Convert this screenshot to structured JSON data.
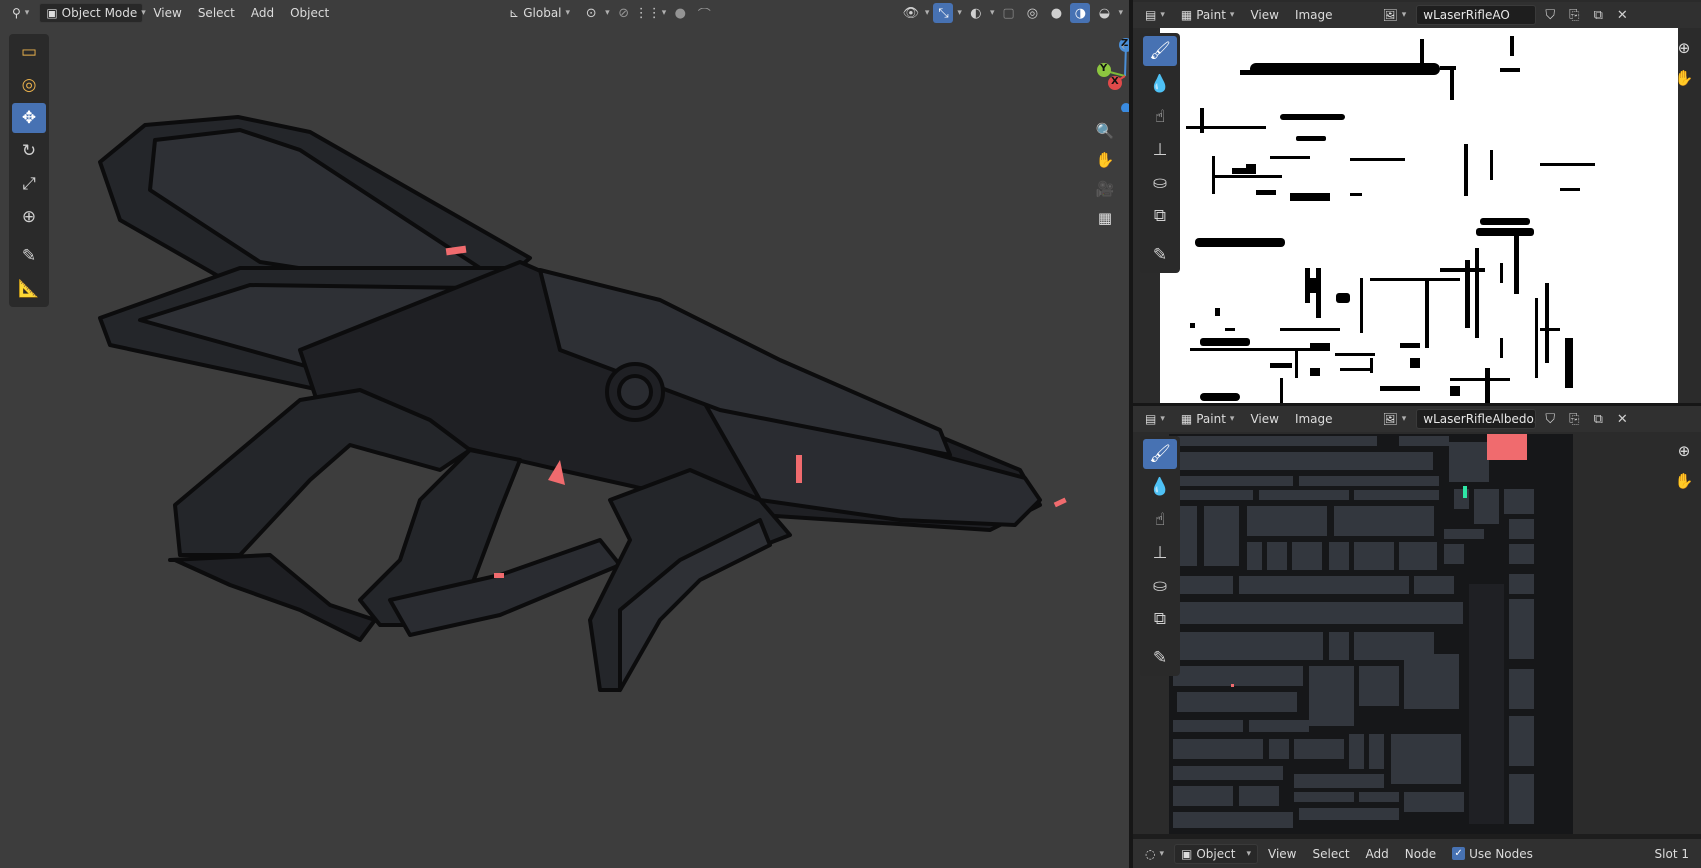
{
  "viewport": {
    "header": {
      "editor_type_icon": "axes-icon",
      "mode": "Object Mode",
      "menus": [
        "View",
        "Select",
        "Add",
        "Object"
      ],
      "orientation": "Global"
    },
    "tools": [
      {
        "name": "select-box-tool",
        "icon": "▭"
      },
      {
        "name": "cursor-tool",
        "icon": "◎"
      },
      {
        "name": "move-tool",
        "icon": "✥",
        "active": true
      },
      {
        "name": "rotate-tool",
        "icon": "↻"
      },
      {
        "name": "scale-tool",
        "icon": "⤢"
      },
      {
        "name": "transform-tool",
        "icon": "⊕"
      },
      {
        "name": "annotate-tool",
        "icon": "✎"
      },
      {
        "name": "measure-tool",
        "icon": "📐"
      }
    ],
    "gizmo": {
      "x": "X",
      "y": "Y",
      "z": "Z"
    },
    "colors": {
      "bg": "#3d3d3d",
      "model_dark": "#1a1b1d",
      "model_mid": "#24262a",
      "model_light": "#2e3035",
      "accent_red": "#f06b6e"
    }
  },
  "image_editor_top": {
    "mode": "Paint",
    "menus": [
      "View",
      "Image"
    ],
    "image_name": "wLaserRifleAO"
  },
  "image_editor_bottom": {
    "mode": "Paint",
    "menus": [
      "View",
      "Image"
    ],
    "image_name": "wLaserRifleAlbedo..."
  },
  "paint_tools": [
    {
      "name": "draw-tool",
      "icon": "🖌",
      "active": true
    },
    {
      "name": "soften-tool",
      "icon": "💧"
    },
    {
      "name": "smear-tool",
      "icon": "☝"
    },
    {
      "name": "clone-tool",
      "icon": "⊥"
    },
    {
      "name": "fill-tool",
      "icon": "⛀"
    },
    {
      "name": "mask-tool",
      "icon": "⧉"
    },
    {
      "name": "annotate-tool",
      "icon": "✎"
    }
  ],
  "node_header": {
    "mode": "Object",
    "menus": [
      "View",
      "Select",
      "Add",
      "Node"
    ],
    "use_nodes_label": "Use Nodes",
    "use_nodes_checked": true,
    "slot": "Slot 1"
  }
}
